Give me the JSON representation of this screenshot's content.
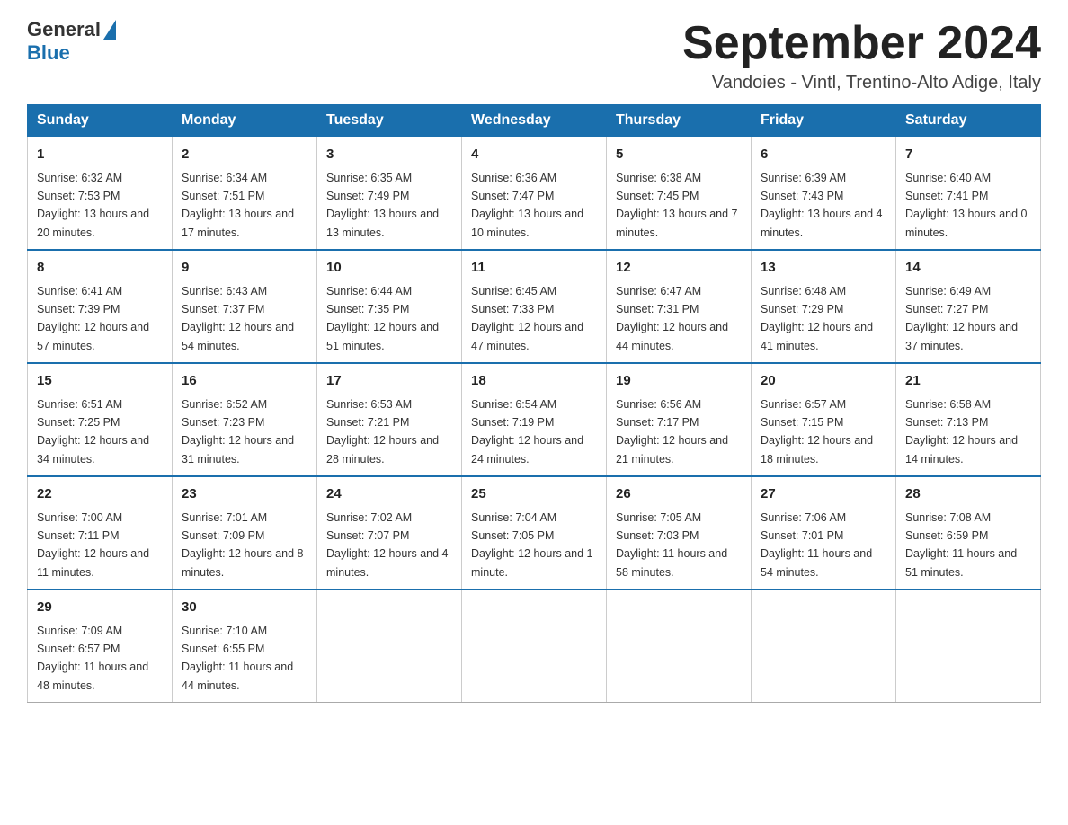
{
  "header": {
    "logo_general": "General",
    "logo_blue": "Blue",
    "month_title": "September 2024",
    "location": "Vandoies - Vintl, Trentino-Alto Adige, Italy"
  },
  "days_of_week": [
    "Sunday",
    "Monday",
    "Tuesday",
    "Wednesday",
    "Thursday",
    "Friday",
    "Saturday"
  ],
  "weeks": [
    [
      {
        "day": "1",
        "sunrise": "6:32 AM",
        "sunset": "7:53 PM",
        "daylight": "13 hours and 20 minutes."
      },
      {
        "day": "2",
        "sunrise": "6:34 AM",
        "sunset": "7:51 PM",
        "daylight": "13 hours and 17 minutes."
      },
      {
        "day": "3",
        "sunrise": "6:35 AM",
        "sunset": "7:49 PM",
        "daylight": "13 hours and 13 minutes."
      },
      {
        "day": "4",
        "sunrise": "6:36 AM",
        "sunset": "7:47 PM",
        "daylight": "13 hours and 10 minutes."
      },
      {
        "day": "5",
        "sunrise": "6:38 AM",
        "sunset": "7:45 PM",
        "daylight": "13 hours and 7 minutes."
      },
      {
        "day": "6",
        "sunrise": "6:39 AM",
        "sunset": "7:43 PM",
        "daylight": "13 hours and 4 minutes."
      },
      {
        "day": "7",
        "sunrise": "6:40 AM",
        "sunset": "7:41 PM",
        "daylight": "13 hours and 0 minutes."
      }
    ],
    [
      {
        "day": "8",
        "sunrise": "6:41 AM",
        "sunset": "7:39 PM",
        "daylight": "12 hours and 57 minutes."
      },
      {
        "day": "9",
        "sunrise": "6:43 AM",
        "sunset": "7:37 PM",
        "daylight": "12 hours and 54 minutes."
      },
      {
        "day": "10",
        "sunrise": "6:44 AM",
        "sunset": "7:35 PM",
        "daylight": "12 hours and 51 minutes."
      },
      {
        "day": "11",
        "sunrise": "6:45 AM",
        "sunset": "7:33 PM",
        "daylight": "12 hours and 47 minutes."
      },
      {
        "day": "12",
        "sunrise": "6:47 AM",
        "sunset": "7:31 PM",
        "daylight": "12 hours and 44 minutes."
      },
      {
        "day": "13",
        "sunrise": "6:48 AM",
        "sunset": "7:29 PM",
        "daylight": "12 hours and 41 minutes."
      },
      {
        "day": "14",
        "sunrise": "6:49 AM",
        "sunset": "7:27 PM",
        "daylight": "12 hours and 37 minutes."
      }
    ],
    [
      {
        "day": "15",
        "sunrise": "6:51 AM",
        "sunset": "7:25 PM",
        "daylight": "12 hours and 34 minutes."
      },
      {
        "day": "16",
        "sunrise": "6:52 AM",
        "sunset": "7:23 PM",
        "daylight": "12 hours and 31 minutes."
      },
      {
        "day": "17",
        "sunrise": "6:53 AM",
        "sunset": "7:21 PM",
        "daylight": "12 hours and 28 minutes."
      },
      {
        "day": "18",
        "sunrise": "6:54 AM",
        "sunset": "7:19 PM",
        "daylight": "12 hours and 24 minutes."
      },
      {
        "day": "19",
        "sunrise": "6:56 AM",
        "sunset": "7:17 PM",
        "daylight": "12 hours and 21 minutes."
      },
      {
        "day": "20",
        "sunrise": "6:57 AM",
        "sunset": "7:15 PM",
        "daylight": "12 hours and 18 minutes."
      },
      {
        "day": "21",
        "sunrise": "6:58 AM",
        "sunset": "7:13 PM",
        "daylight": "12 hours and 14 minutes."
      }
    ],
    [
      {
        "day": "22",
        "sunrise": "7:00 AM",
        "sunset": "7:11 PM",
        "daylight": "12 hours and 11 minutes."
      },
      {
        "day": "23",
        "sunrise": "7:01 AM",
        "sunset": "7:09 PM",
        "daylight": "12 hours and 8 minutes."
      },
      {
        "day": "24",
        "sunrise": "7:02 AM",
        "sunset": "7:07 PM",
        "daylight": "12 hours and 4 minutes."
      },
      {
        "day": "25",
        "sunrise": "7:04 AM",
        "sunset": "7:05 PM",
        "daylight": "12 hours and 1 minute."
      },
      {
        "day": "26",
        "sunrise": "7:05 AM",
        "sunset": "7:03 PM",
        "daylight": "11 hours and 58 minutes."
      },
      {
        "day": "27",
        "sunrise": "7:06 AM",
        "sunset": "7:01 PM",
        "daylight": "11 hours and 54 minutes."
      },
      {
        "day": "28",
        "sunrise": "7:08 AM",
        "sunset": "6:59 PM",
        "daylight": "11 hours and 51 minutes."
      }
    ],
    [
      {
        "day": "29",
        "sunrise": "7:09 AM",
        "sunset": "6:57 PM",
        "daylight": "11 hours and 48 minutes."
      },
      {
        "day": "30",
        "sunrise": "7:10 AM",
        "sunset": "6:55 PM",
        "daylight": "11 hours and 44 minutes."
      },
      null,
      null,
      null,
      null,
      null
    ]
  ]
}
